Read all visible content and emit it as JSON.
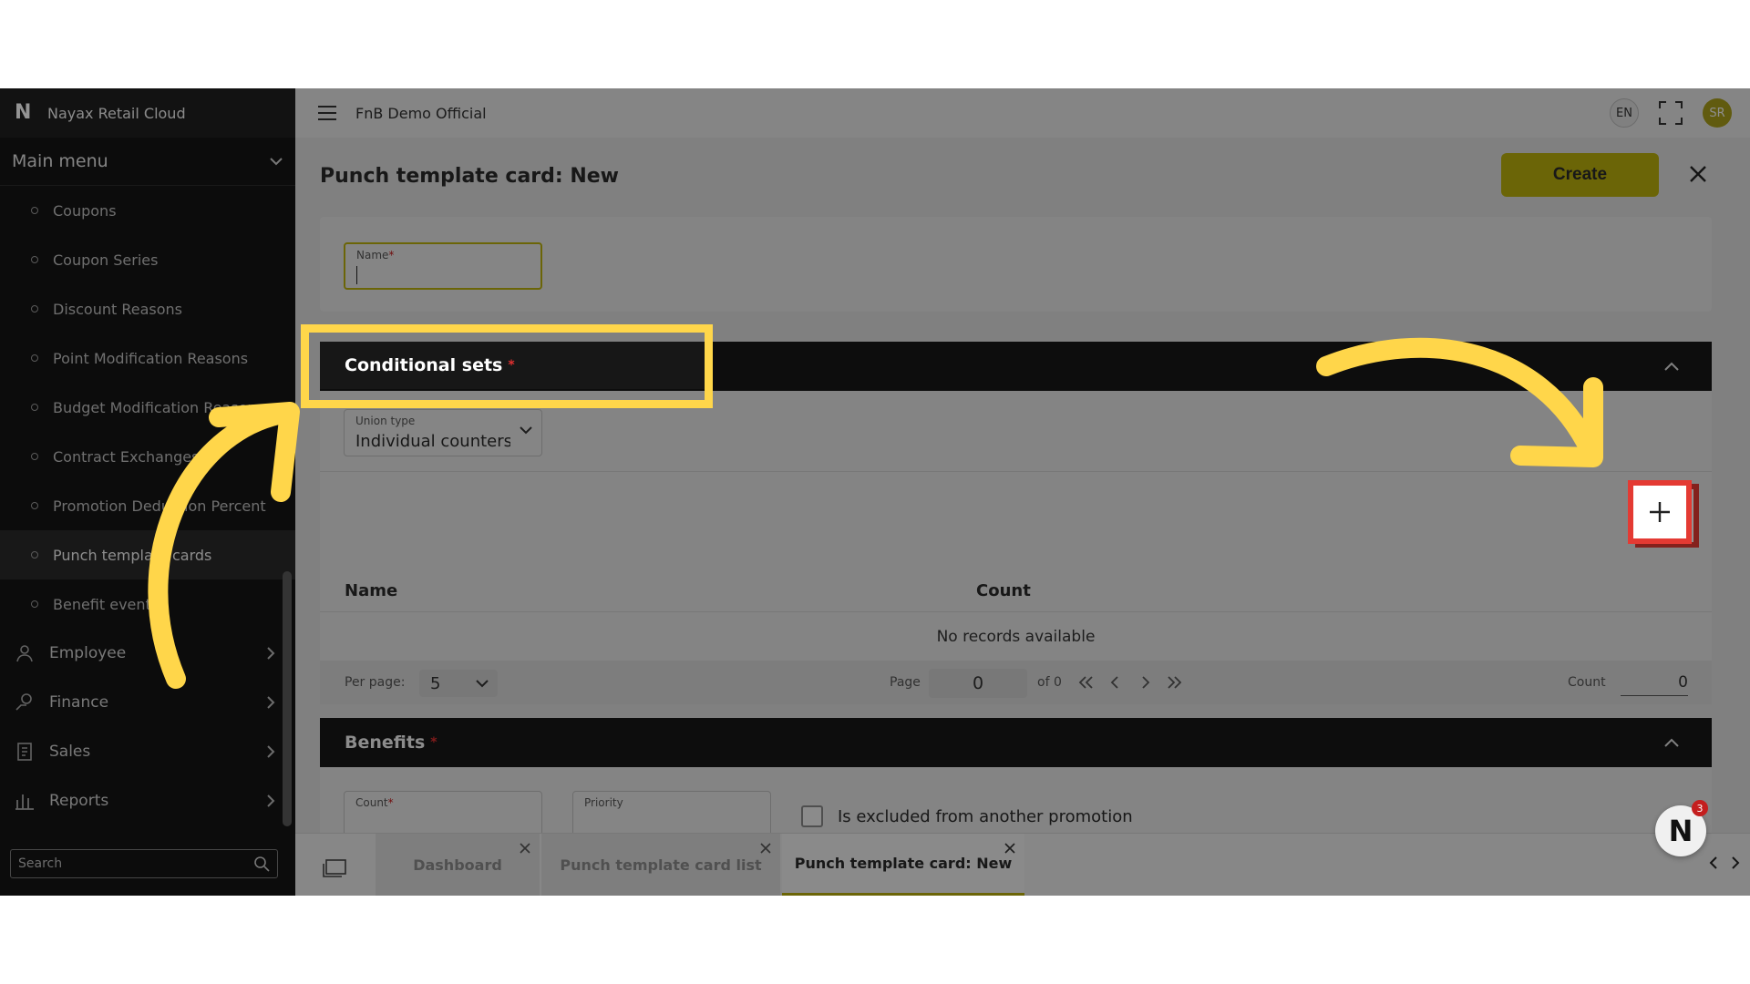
{
  "app": {
    "brand": "Nayax Retail Cloud",
    "company": "FnB Demo Official",
    "lang": "EN",
    "user_initials": "SR"
  },
  "sidebar": {
    "main_menu": "Main menu",
    "items": [
      {
        "label": "Coupons"
      },
      {
        "label": "Coupon Series"
      },
      {
        "label": "Discount Reasons"
      },
      {
        "label": "Point Modification Reasons"
      },
      {
        "label": "Budget Modification Reasons"
      },
      {
        "label": "Contract Exchanges"
      },
      {
        "label": "Promotion Deduction Percent"
      },
      {
        "label": "Punch template cards",
        "active": true
      },
      {
        "label": "Benefit events"
      }
    ],
    "groups": [
      {
        "label": "Employee",
        "icon": "employee-icon"
      },
      {
        "label": "Finance",
        "icon": "finance-icon"
      },
      {
        "label": "Sales",
        "icon": "sales-icon"
      },
      {
        "label": "Reports",
        "icon": "reports-icon"
      }
    ],
    "search_placeholder": "Search"
  },
  "page": {
    "title": "Punch template card: New",
    "create_label": "Create"
  },
  "form": {
    "name_label": "Name",
    "required_mark": "*"
  },
  "conditional_sets": {
    "title": "Conditional sets",
    "union_label": "Union type",
    "union_value": "Individual counters",
    "columns": [
      "Name",
      "Count"
    ],
    "empty_text": "No records available",
    "pager": {
      "per_page_label": "Per page:",
      "per_page_value": "5",
      "page_label": "Page",
      "page_value": "0",
      "of_label": "of 0",
      "count_label": "Count",
      "count_value": "0"
    }
  },
  "benefits": {
    "title": "Benefits",
    "count_label": "Count",
    "priority_label": "Priority",
    "excluded_label": "Is excluded from another promotion"
  },
  "tabs": [
    {
      "label": "Dashboard"
    },
    {
      "label": "Punch template card list"
    },
    {
      "label": "Punch template card: New",
      "active": true
    }
  ],
  "notifications": {
    "count": "3"
  },
  "colors": {
    "accent": "#b9ae0d",
    "highlight": "#ffd64a",
    "add_outline": "#e43a33"
  }
}
